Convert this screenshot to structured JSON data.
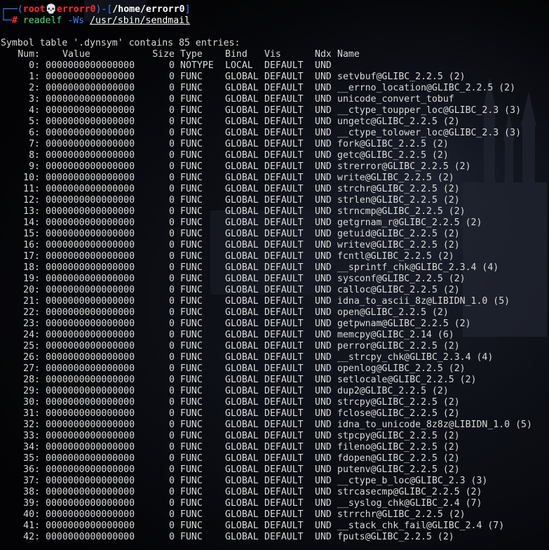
{
  "prompt": {
    "box_top_prefix": "┌──(",
    "user": "root",
    "skull": "💀",
    "host": "errorr0",
    "mid": ")-[",
    "path": "/home/errorr0",
    "close": "]",
    "box_bottom_prefix": "└─",
    "hash": "#",
    "command": "readelf",
    "flag": "-Ws",
    "target": "/usr/sbin/sendmail"
  },
  "output": {
    "header_line": "Symbol table '.dynsym' contains 85 entries:",
    "columns": {
      "num": "Num:",
      "value": "Value",
      "size": "Size",
      "type": "Type",
      "bind": "Bind",
      "vis": "Vis",
      "ndx": "Ndx",
      "name": "Name"
    },
    "rows": [
      {
        "num": "0:",
        "value": "0000000000000000",
        "size": "0",
        "type": "NOTYPE",
        "bind": "LOCAL",
        "vis": "DEFAULT",
        "ndx": "UND",
        "name": ""
      },
      {
        "num": "1:",
        "value": "0000000000000000",
        "size": "0",
        "type": "FUNC",
        "bind": "GLOBAL",
        "vis": "DEFAULT",
        "ndx": "UND",
        "name": "setvbuf@GLIBC_2.2.5 (2)"
      },
      {
        "num": "2:",
        "value": "0000000000000000",
        "size": "0",
        "type": "FUNC",
        "bind": "GLOBAL",
        "vis": "DEFAULT",
        "ndx": "UND",
        "name": "__errno_location@GLIBC_2.2.5 (2)"
      },
      {
        "num": "3:",
        "value": "0000000000000000",
        "size": "0",
        "type": "FUNC",
        "bind": "GLOBAL",
        "vis": "DEFAULT",
        "ndx": "UND",
        "name": "unicode_convert_tobuf"
      },
      {
        "num": "4:",
        "value": "0000000000000000",
        "size": "0",
        "type": "FUNC",
        "bind": "GLOBAL",
        "vis": "DEFAULT",
        "ndx": "UND",
        "name": "__ctype_toupper_loc@GLIBC_2.3 (3)"
      },
      {
        "num": "5:",
        "value": "0000000000000000",
        "size": "0",
        "type": "FUNC",
        "bind": "GLOBAL",
        "vis": "DEFAULT",
        "ndx": "UND",
        "name": "ungetc@GLIBC_2.2.5 (2)"
      },
      {
        "num": "6:",
        "value": "0000000000000000",
        "size": "0",
        "type": "FUNC",
        "bind": "GLOBAL",
        "vis": "DEFAULT",
        "ndx": "UND",
        "name": "__ctype_tolower_loc@GLIBC_2.3 (3)"
      },
      {
        "num": "7:",
        "value": "0000000000000000",
        "size": "0",
        "type": "FUNC",
        "bind": "GLOBAL",
        "vis": "DEFAULT",
        "ndx": "UND",
        "name": "fork@GLIBC_2.2.5 (2)"
      },
      {
        "num": "8:",
        "value": "0000000000000000",
        "size": "0",
        "type": "FUNC",
        "bind": "GLOBAL",
        "vis": "DEFAULT",
        "ndx": "UND",
        "name": "getc@GLIBC_2.2.5 (2)"
      },
      {
        "num": "9:",
        "value": "0000000000000000",
        "size": "0",
        "type": "FUNC",
        "bind": "GLOBAL",
        "vis": "DEFAULT",
        "ndx": "UND",
        "name": "strerror@GLIBC_2.2.5 (2)"
      },
      {
        "num": "10:",
        "value": "0000000000000000",
        "size": "0",
        "type": "FUNC",
        "bind": "GLOBAL",
        "vis": "DEFAULT",
        "ndx": "UND",
        "name": "write@GLIBC_2.2.5 (2)"
      },
      {
        "num": "11:",
        "value": "0000000000000000",
        "size": "0",
        "type": "FUNC",
        "bind": "GLOBAL",
        "vis": "DEFAULT",
        "ndx": "UND",
        "name": "strchr@GLIBC_2.2.5 (2)"
      },
      {
        "num": "12:",
        "value": "0000000000000000",
        "size": "0",
        "type": "FUNC",
        "bind": "GLOBAL",
        "vis": "DEFAULT",
        "ndx": "UND",
        "name": "strlen@GLIBC_2.2.5 (2)"
      },
      {
        "num": "13:",
        "value": "0000000000000000",
        "size": "0",
        "type": "FUNC",
        "bind": "GLOBAL",
        "vis": "DEFAULT",
        "ndx": "UND",
        "name": "strncmp@GLIBC_2.2.5 (2)"
      },
      {
        "num": "14:",
        "value": "0000000000000000",
        "size": "0",
        "type": "FUNC",
        "bind": "GLOBAL",
        "vis": "DEFAULT",
        "ndx": "UND",
        "name": "getgrnam_r@GLIBC_2.2.5 (2)"
      },
      {
        "num": "15:",
        "value": "0000000000000000",
        "size": "0",
        "type": "FUNC",
        "bind": "GLOBAL",
        "vis": "DEFAULT",
        "ndx": "UND",
        "name": "getuid@GLIBC_2.2.5 (2)"
      },
      {
        "num": "16:",
        "value": "0000000000000000",
        "size": "0",
        "type": "FUNC",
        "bind": "GLOBAL",
        "vis": "DEFAULT",
        "ndx": "UND",
        "name": "writev@GLIBC_2.2.5 (2)"
      },
      {
        "num": "17:",
        "value": "0000000000000000",
        "size": "0",
        "type": "FUNC",
        "bind": "GLOBAL",
        "vis": "DEFAULT",
        "ndx": "UND",
        "name": "fcntl@GLIBC_2.2.5 (2)"
      },
      {
        "num": "18:",
        "value": "0000000000000000",
        "size": "0",
        "type": "FUNC",
        "bind": "GLOBAL",
        "vis": "DEFAULT",
        "ndx": "UND",
        "name": "__sprintf_chk@GLIBC_2.3.4 (4)"
      },
      {
        "num": "19:",
        "value": "0000000000000000",
        "size": "0",
        "type": "FUNC",
        "bind": "GLOBAL",
        "vis": "DEFAULT",
        "ndx": "UND",
        "name": "sysconf@GLIBC_2.2.5 (2)"
      },
      {
        "num": "20:",
        "value": "0000000000000000",
        "size": "0",
        "type": "FUNC",
        "bind": "GLOBAL",
        "vis": "DEFAULT",
        "ndx": "UND",
        "name": "calloc@GLIBC_2.2.5 (2)"
      },
      {
        "num": "21:",
        "value": "0000000000000000",
        "size": "0",
        "type": "FUNC",
        "bind": "GLOBAL",
        "vis": "DEFAULT",
        "ndx": "UND",
        "name": "idna_to_ascii_8z@LIBIDN_1.0 (5)"
      },
      {
        "num": "22:",
        "value": "0000000000000000",
        "size": "0",
        "type": "FUNC",
        "bind": "GLOBAL",
        "vis": "DEFAULT",
        "ndx": "UND",
        "name": "open@GLIBC_2.2.5 (2)"
      },
      {
        "num": "23:",
        "value": "0000000000000000",
        "size": "0",
        "type": "FUNC",
        "bind": "GLOBAL",
        "vis": "DEFAULT",
        "ndx": "UND",
        "name": "getpwnam@GLIBC_2.2.5 (2)"
      },
      {
        "num": "24:",
        "value": "0000000000000000",
        "size": "0",
        "type": "FUNC",
        "bind": "GLOBAL",
        "vis": "DEFAULT",
        "ndx": "UND",
        "name": "memcpy@GLIBC_2.14 (6)"
      },
      {
        "num": "25:",
        "value": "0000000000000000",
        "size": "0",
        "type": "FUNC",
        "bind": "GLOBAL",
        "vis": "DEFAULT",
        "ndx": "UND",
        "name": "perror@GLIBC_2.2.5 (2)"
      },
      {
        "num": "26:",
        "value": "0000000000000000",
        "size": "0",
        "type": "FUNC",
        "bind": "GLOBAL",
        "vis": "DEFAULT",
        "ndx": "UND",
        "name": "__strcpy_chk@GLIBC_2.3.4 (4)"
      },
      {
        "num": "27:",
        "value": "0000000000000000",
        "size": "0",
        "type": "FUNC",
        "bind": "GLOBAL",
        "vis": "DEFAULT",
        "ndx": "UND",
        "name": "openlog@GLIBC_2.2.5 (2)"
      },
      {
        "num": "28:",
        "value": "0000000000000000",
        "size": "0",
        "type": "FUNC",
        "bind": "GLOBAL",
        "vis": "DEFAULT",
        "ndx": "UND",
        "name": "setlocale@GLIBC_2.2.5 (2)"
      },
      {
        "num": "29:",
        "value": "0000000000000000",
        "size": "0",
        "type": "FUNC",
        "bind": "GLOBAL",
        "vis": "DEFAULT",
        "ndx": "UND",
        "name": "dup2@GLIBC_2.2.5 (2)"
      },
      {
        "num": "30:",
        "value": "0000000000000000",
        "size": "0",
        "type": "FUNC",
        "bind": "GLOBAL",
        "vis": "DEFAULT",
        "ndx": "UND",
        "name": "strcpy@GLIBC_2.2.5 (2)"
      },
      {
        "num": "31:",
        "value": "0000000000000000",
        "size": "0",
        "type": "FUNC",
        "bind": "GLOBAL",
        "vis": "DEFAULT",
        "ndx": "UND",
        "name": "fclose@GLIBC_2.2.5 (2)"
      },
      {
        "num": "32:",
        "value": "0000000000000000",
        "size": "0",
        "type": "FUNC",
        "bind": "GLOBAL",
        "vis": "DEFAULT",
        "ndx": "UND",
        "name": "idna_to_unicode_8z8z@LIBIDN_1.0 (5)"
      },
      {
        "num": "33:",
        "value": "0000000000000000",
        "size": "0",
        "type": "FUNC",
        "bind": "GLOBAL",
        "vis": "DEFAULT",
        "ndx": "UND",
        "name": "stpcpy@GLIBC_2.2.5 (2)"
      },
      {
        "num": "34:",
        "value": "0000000000000000",
        "size": "0",
        "type": "FUNC",
        "bind": "GLOBAL",
        "vis": "DEFAULT",
        "ndx": "UND",
        "name": "fileno@GLIBC_2.2.5 (2)"
      },
      {
        "num": "35:",
        "value": "0000000000000000",
        "size": "0",
        "type": "FUNC",
        "bind": "GLOBAL",
        "vis": "DEFAULT",
        "ndx": "UND",
        "name": "fdopen@GLIBC_2.2.5 (2)"
      },
      {
        "num": "36:",
        "value": "0000000000000000",
        "size": "0",
        "type": "FUNC",
        "bind": "GLOBAL",
        "vis": "DEFAULT",
        "ndx": "UND",
        "name": "putenv@GLIBC_2.2.5 (2)"
      },
      {
        "num": "37:",
        "value": "0000000000000000",
        "size": "0",
        "type": "FUNC",
        "bind": "GLOBAL",
        "vis": "DEFAULT",
        "ndx": "UND",
        "name": "__ctype_b_loc@GLIBC_2.3 (3)"
      },
      {
        "num": "38:",
        "value": "0000000000000000",
        "size": "0",
        "type": "FUNC",
        "bind": "GLOBAL",
        "vis": "DEFAULT",
        "ndx": "UND",
        "name": "strcasecmp@GLIBC_2.2.5 (2)"
      },
      {
        "num": "39:",
        "value": "0000000000000000",
        "size": "0",
        "type": "FUNC",
        "bind": "GLOBAL",
        "vis": "DEFAULT",
        "ndx": "UND",
        "name": "__syslog_chk@GLIBC_2.4 (7)"
      },
      {
        "num": "40:",
        "value": "0000000000000000",
        "size": "0",
        "type": "FUNC",
        "bind": "GLOBAL",
        "vis": "DEFAULT",
        "ndx": "UND",
        "name": "strrchr@GLIBC_2.2.5 (2)"
      },
      {
        "num": "41:",
        "value": "0000000000000000",
        "size": "0",
        "type": "FUNC",
        "bind": "GLOBAL",
        "vis": "DEFAULT",
        "ndx": "UND",
        "name": "__stack_chk_fail@GLIBC_2.4 (7)"
      },
      {
        "num": "42:",
        "value": "0000000000000000",
        "size": "0",
        "type": "FUNC",
        "bind": "GLOBAL",
        "vis": "DEFAULT",
        "ndx": "UND",
        "name": "fputs@GLIBC_2.2.5 (2)"
      }
    ]
  },
  "colors": {
    "prompt_box": "#3b82f6",
    "root_user": "#ff2d2d",
    "command": "#4ade80",
    "flag": "#3b82f6",
    "text": "#d9d9d9"
  }
}
